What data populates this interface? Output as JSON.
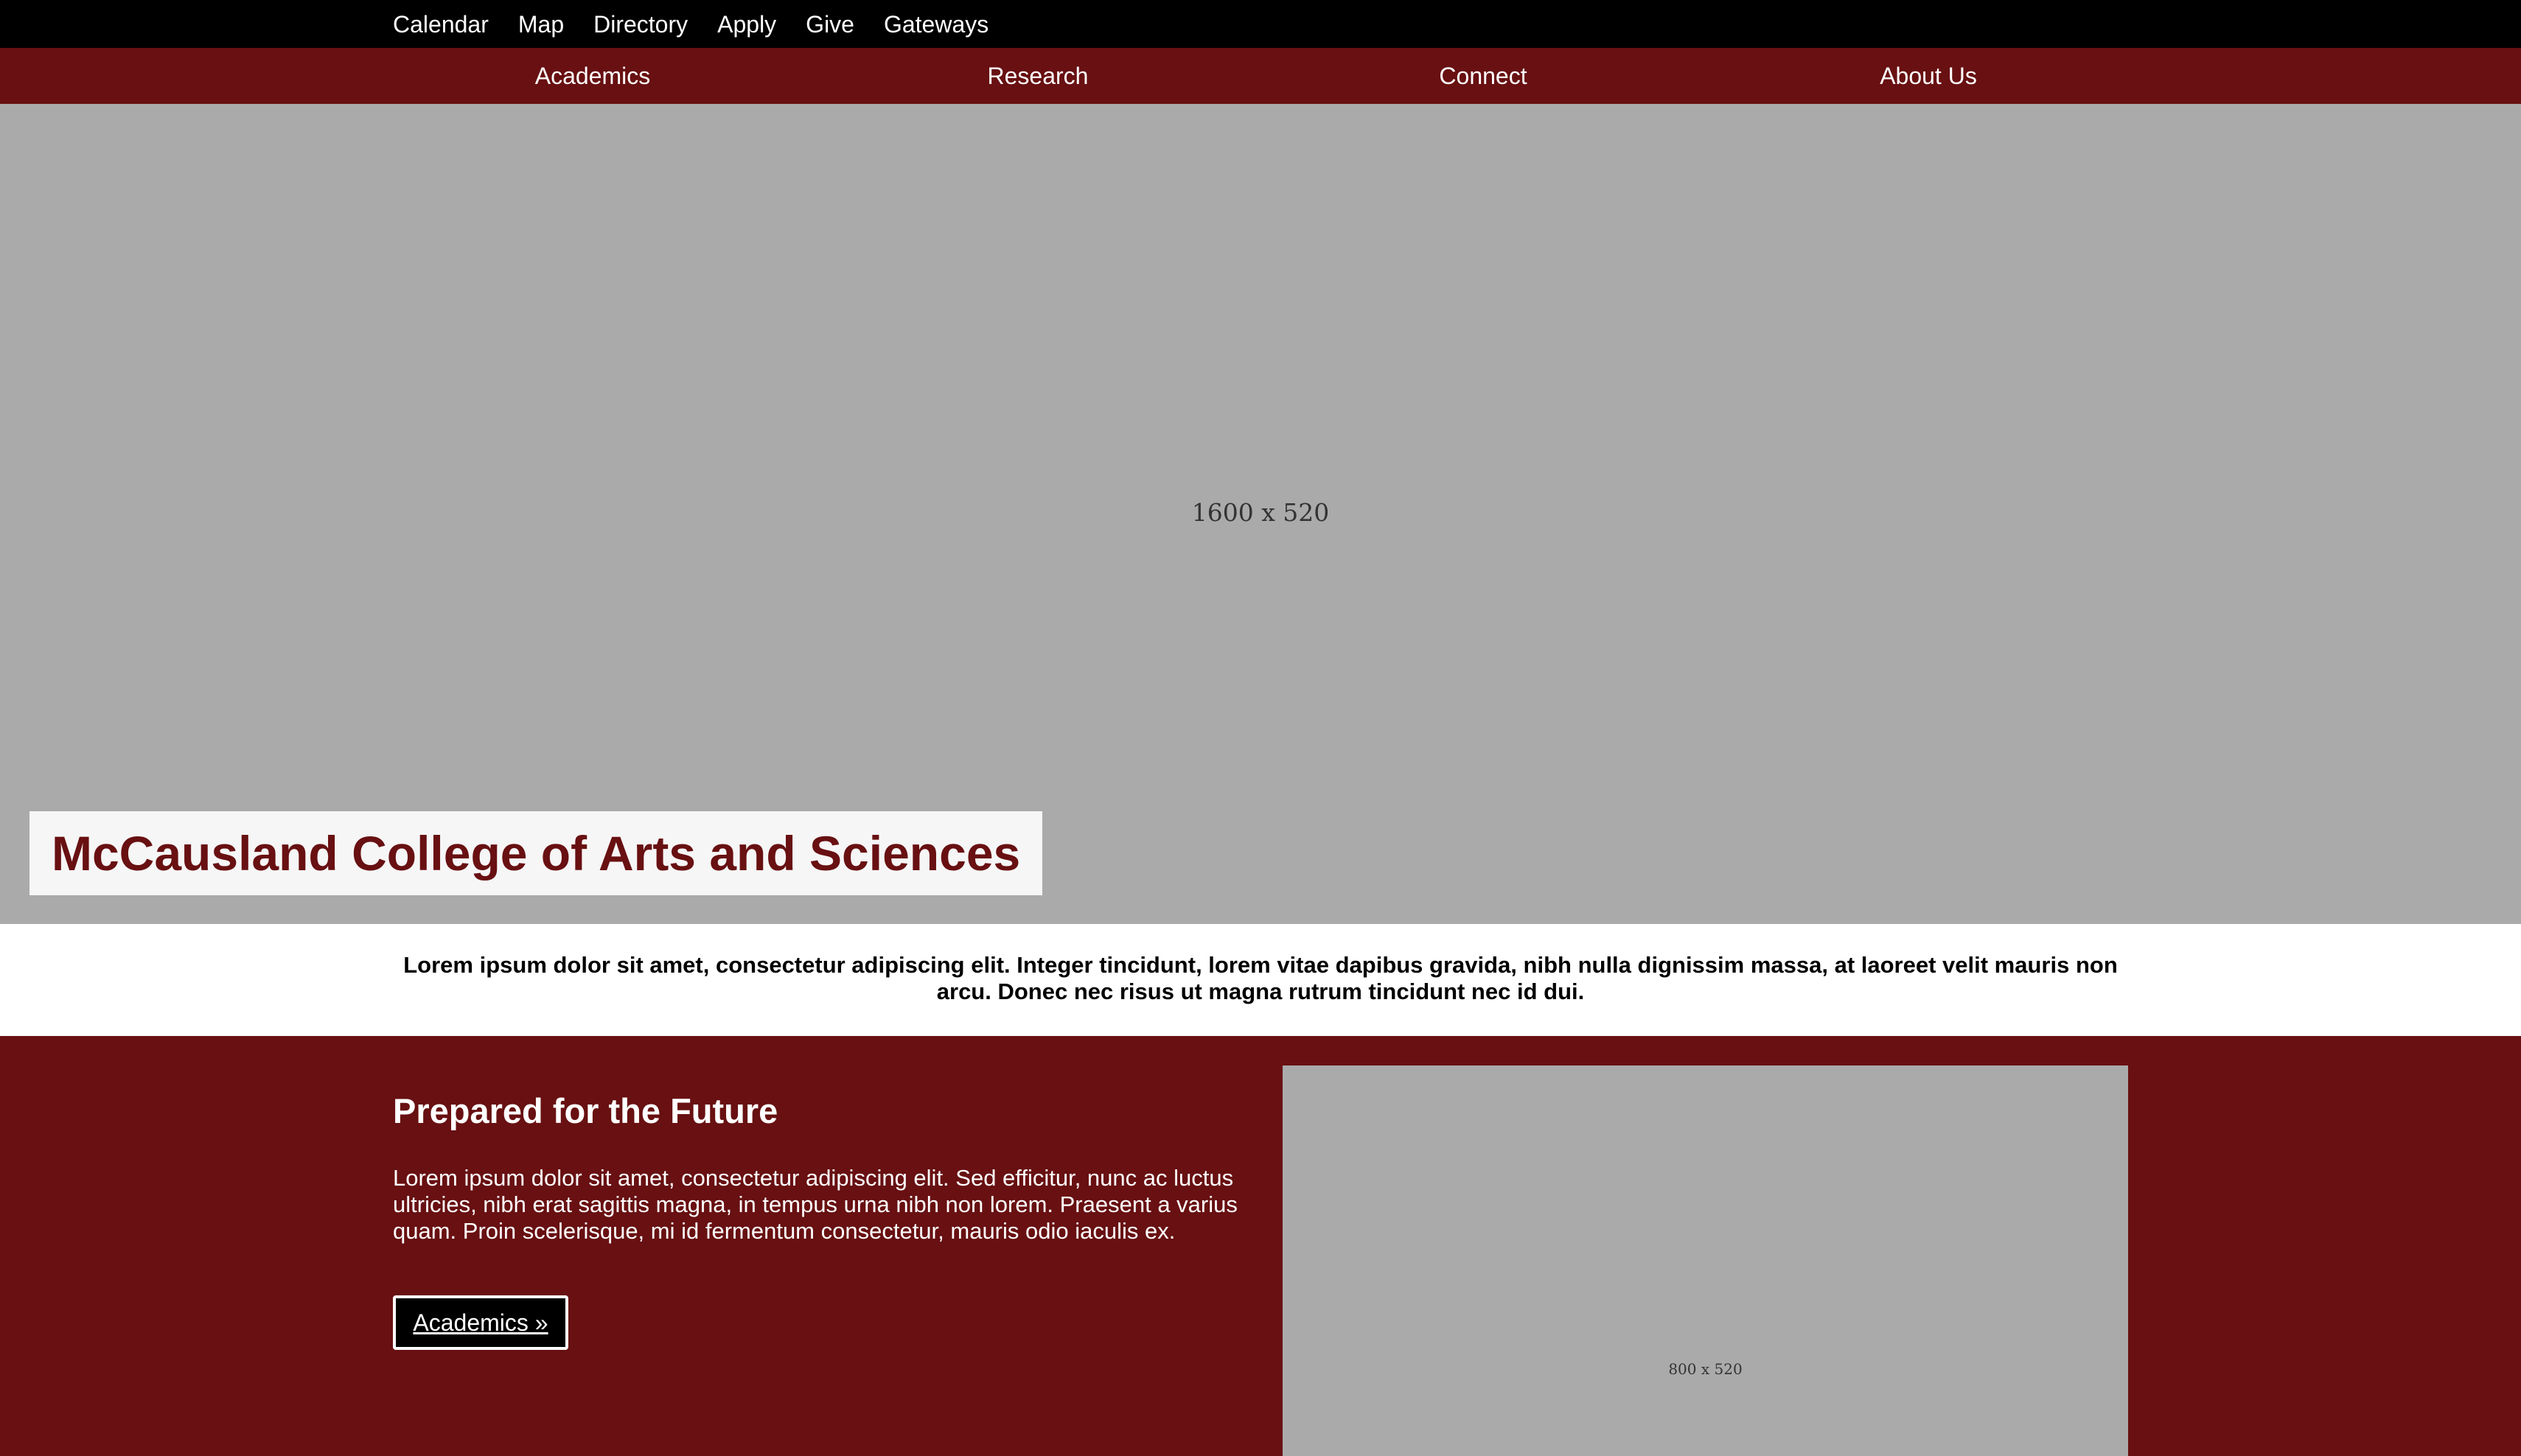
{
  "utility_nav": {
    "items": [
      "Calendar",
      "Map",
      "Directory",
      "Apply",
      "Give",
      "Gateways"
    ]
  },
  "main_nav": {
    "items": [
      "Academics",
      "Research",
      "Connect",
      "About Us"
    ]
  },
  "hero": {
    "image_label": "1600 x 520",
    "title": "McCausland College of Arts and Sciences"
  },
  "intro": {
    "text": "Lorem ipsum dolor sit amet, consectetur adipiscing elit. Integer tincidunt, lorem vitae dapibus gravida, nibh nulla dignissim massa, at laoreet velit mauris non arcu. Donec nec risus ut magna rutrum tincidunt nec id dui."
  },
  "feature": {
    "heading": "Prepared for the Future",
    "body": "Lorem ipsum dolor sit amet, consectetur adipiscing elit. Sed efficitur, nunc ac luctus ultricies, nibh erat sagittis magna, in tempus urna nibh non lorem. Praesent a varius quam. Proin scelerisque, mi id fermentum consectetur, mauris odio iaculis ex.",
    "button_label": "Academics »",
    "image_label": "800 x 520"
  },
  "colors": {
    "brand_maroon": "#681012",
    "utility_black": "#000000",
    "placeholder_gray": "#aaaaaa",
    "title_box_bg": "#f6f6f6"
  }
}
